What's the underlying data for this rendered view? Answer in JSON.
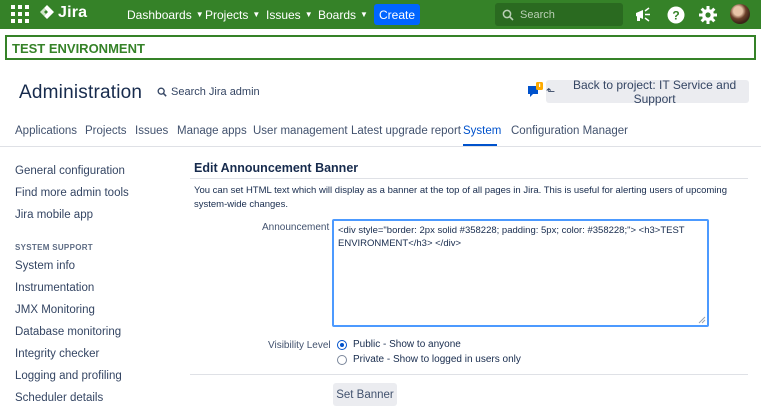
{
  "topbar": {
    "logo_text": "Jira",
    "nav": [
      {
        "label": "Dashboards"
      },
      {
        "label": "Projects"
      },
      {
        "label": "Issues"
      },
      {
        "label": "Boards"
      }
    ],
    "create_label": "Create",
    "search_placeholder": "Search",
    "icons": [
      "app-switcher-icon",
      "jira-logo-icon",
      "search-icon",
      "megaphone-icon",
      "help-icon",
      "settings-icon",
      "avatar"
    ],
    "bg_color": "#358228"
  },
  "env_banner": {
    "text": "TEST ENVIRONMENT",
    "color": "#358228"
  },
  "header": {
    "title": "Administration",
    "search_label": "Search Jira admin",
    "back_label": "Back to project: IT Service and Support"
  },
  "tabs": [
    {
      "label": "Applications"
    },
    {
      "label": "Projects"
    },
    {
      "label": "Issues"
    },
    {
      "label": "Manage apps"
    },
    {
      "label": "User management"
    },
    {
      "label": "Latest upgrade report"
    },
    {
      "label": "System",
      "active": true
    },
    {
      "label": "Configuration Manager"
    }
  ],
  "sidebar": {
    "items_top": [
      "General configuration",
      "Find more admin tools",
      "Jira mobile app"
    ],
    "section_heading": "SYSTEM SUPPORT",
    "items_support": [
      "System info",
      "Instrumentation",
      "JMX Monitoring",
      "Database monitoring",
      "Integrity checker",
      "Logging and profiling",
      "Scheduler details"
    ]
  },
  "form": {
    "title": "Edit Announcement Banner",
    "description": "You can set HTML text which will display as a banner at the top of all pages in Jira. This is useful for alerting users of upcoming system-wide changes.",
    "announcement_label": "Announcement",
    "announcement_value": "<div style=\"border: 2px solid #358228; padding: 5px; color: #358228;\"> <h3>TEST ENVIRONMENT</h3> </div>",
    "visibility_label": "Visibility Level",
    "visibility_options": [
      {
        "label": "Public - Show to anyone",
        "selected": true
      },
      {
        "label": "Private - Show to logged in users only",
        "selected": false
      }
    ],
    "submit_label": "Set Banner"
  }
}
